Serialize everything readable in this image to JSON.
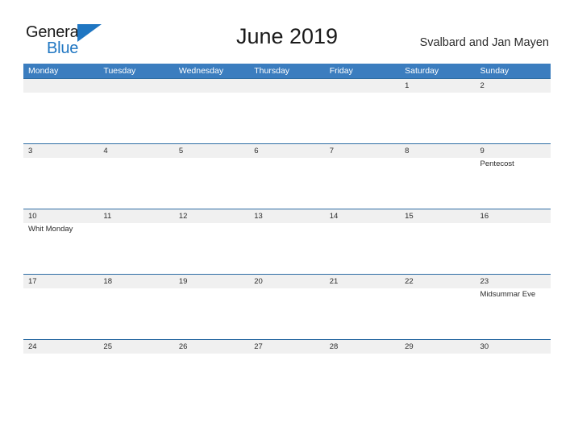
{
  "brand": {
    "name_part1": "General",
    "name_part2": "Blue",
    "triangle_icon": "triangle-icon",
    "accent_color": "#1f76c2"
  },
  "header": {
    "title": "June 2019",
    "region": "Svalbard and Jan Mayen"
  },
  "colors": {
    "header_blue": "#3b7dbf",
    "rule_blue": "#2e6da4",
    "date_band_gray": "#f0f0f0",
    "text_dark": "#2b2b2b"
  },
  "weekday_headers": [
    "Monday",
    "Tuesday",
    "Wednesday",
    "Thursday",
    "Friday",
    "Saturday",
    "Sunday"
  ],
  "weeks": [
    {
      "days": [
        {
          "date": "",
          "event": ""
        },
        {
          "date": "",
          "event": ""
        },
        {
          "date": "",
          "event": ""
        },
        {
          "date": "",
          "event": ""
        },
        {
          "date": "",
          "event": ""
        },
        {
          "date": "1",
          "event": ""
        },
        {
          "date": "2",
          "event": ""
        }
      ]
    },
    {
      "days": [
        {
          "date": "3",
          "event": ""
        },
        {
          "date": "4",
          "event": ""
        },
        {
          "date": "5",
          "event": ""
        },
        {
          "date": "6",
          "event": ""
        },
        {
          "date": "7",
          "event": ""
        },
        {
          "date": "8",
          "event": ""
        },
        {
          "date": "9",
          "event": "Pentecost"
        }
      ]
    },
    {
      "days": [
        {
          "date": "10",
          "event": "Whit Monday"
        },
        {
          "date": "11",
          "event": ""
        },
        {
          "date": "12",
          "event": ""
        },
        {
          "date": "13",
          "event": ""
        },
        {
          "date": "14",
          "event": ""
        },
        {
          "date": "15",
          "event": ""
        },
        {
          "date": "16",
          "event": ""
        }
      ]
    },
    {
      "days": [
        {
          "date": "17",
          "event": ""
        },
        {
          "date": "18",
          "event": ""
        },
        {
          "date": "19",
          "event": ""
        },
        {
          "date": "20",
          "event": ""
        },
        {
          "date": "21",
          "event": ""
        },
        {
          "date": "22",
          "event": ""
        },
        {
          "date": "23",
          "event": "Midsummar Eve"
        }
      ]
    },
    {
      "days": [
        {
          "date": "24",
          "event": ""
        },
        {
          "date": "25",
          "event": ""
        },
        {
          "date": "26",
          "event": ""
        },
        {
          "date": "27",
          "event": ""
        },
        {
          "date": "28",
          "event": ""
        },
        {
          "date": "29",
          "event": ""
        },
        {
          "date": "30",
          "event": ""
        }
      ]
    }
  ]
}
